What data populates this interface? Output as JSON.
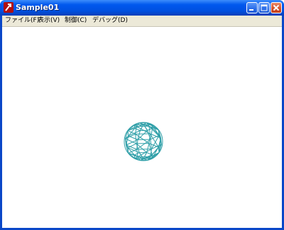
{
  "window": {
    "title": "Sample01"
  },
  "menu": [
    {
      "label": "ファイル(F)"
    },
    {
      "label": "表示(V)"
    },
    {
      "label": "制御(C)"
    },
    {
      "label": "デバッグ(D)"
    }
  ],
  "canvas": {
    "object": "wireframe-sphere",
    "stroke_color": "#2f9fa8"
  },
  "colors": {
    "titlebar": "#0058ee",
    "close_button": "#d9532c",
    "menubar": "#ece9d8"
  }
}
